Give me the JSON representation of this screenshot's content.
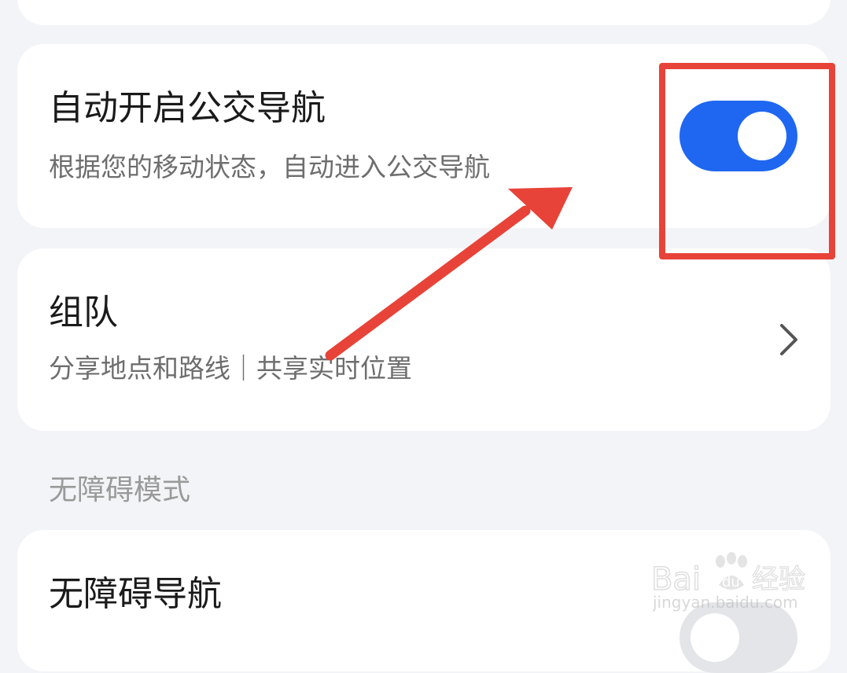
{
  "bus_nav": {
    "title": "自动开启公交导航",
    "subtitle": "根据您的移动状态，自动进入公交导航",
    "enabled": true
  },
  "team": {
    "title": "组队",
    "subtitle": "分享地点和路线｜共享实时位置"
  },
  "accessibility_section": {
    "label": "无障碍模式"
  },
  "accessible_nav": {
    "title": "无障碍导航"
  },
  "watermark": {
    "logo_text": "Baidu经验",
    "url": "jingyan.baidu.com"
  },
  "colors": {
    "toggle_on": "#1f67f1",
    "annotation": "#e84338",
    "background": "#f3f4f7"
  }
}
